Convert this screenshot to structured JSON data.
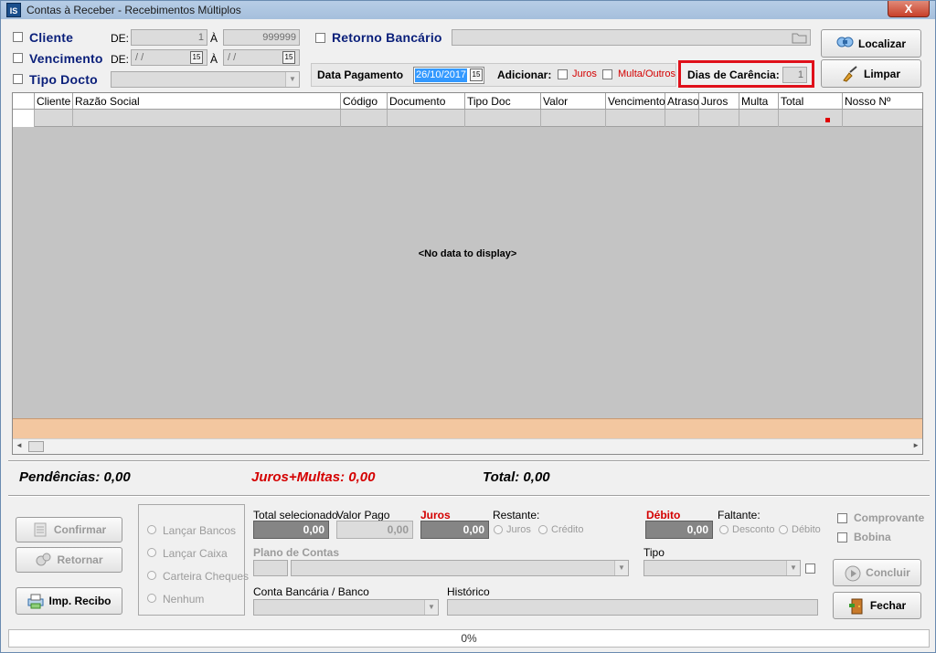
{
  "window": {
    "title": "Contas à Receber - Recebimentos Múltiplos",
    "app_icon_text": "IS",
    "close_label": "X"
  },
  "filters": {
    "cliente_label": "Cliente",
    "de_label": "DE:",
    "ate_label": "À",
    "cliente_from": "1",
    "cliente_to": "999999",
    "vencimento_label": "Vencimento",
    "venc_from": "/ /",
    "venc_to": "/ /",
    "tipo_docto_label": "Tipo Docto",
    "retorno_label": "Retorno Bancário"
  },
  "payment": {
    "data_pagamento_label": "Data Pagamento",
    "data_pagamento_value": "26/10/2017",
    "adicionar_label": "Adicionar:",
    "juros_label": "Juros",
    "multa_label": "Multa/Outros",
    "dias_carencia_label": "Dias de Carência:",
    "dias_carencia_value": "1"
  },
  "buttons": {
    "localizar": "Localizar",
    "limpar": "Limpar",
    "confirmar": "Confirmar",
    "retornar": "Retornar",
    "imp_recibo": "Imp. Recibo",
    "concluir": "Concluir",
    "fechar": "Fechar"
  },
  "grid": {
    "columns": [
      "Cliente",
      "Razão Social",
      "Código",
      "Documento",
      "Tipo Doc",
      "Valor",
      "Vencimento",
      "Atraso",
      "Juros",
      "Multa",
      "Total",
      "Nosso Nº"
    ],
    "empty_text": "<No data to display>"
  },
  "totals": {
    "pendencias": "Pendências: 0,00",
    "juros_multas": "Juros+Multas: 0,00",
    "total": "Total: 0,00"
  },
  "actions": {
    "lancar_bancos": "Lançar Bancos",
    "lancar_caixa": "Lançar Caixa",
    "carteira_cheques": "Carteira Cheques",
    "nenhum": "Nenhum"
  },
  "values": {
    "total_selecionado_label": "Total selecionado",
    "total_selecionado": "0,00",
    "valor_pago_label": "Valor Pago",
    "valor_pago": "0,00",
    "juros_label": "Juros",
    "juros": "0,00",
    "restante_label": "Restante:",
    "restante_juros": "Juros",
    "restante_credito": "Crédito",
    "debito_label": "Débito",
    "debito": "0,00",
    "faltante_label": "Faltante:",
    "faltante_desconto": "Desconto",
    "faltante_debito": "Débito",
    "plano_contas_label": "Plano de Contas",
    "tipo_label": "Tipo",
    "conta_bancaria_label": "Conta Bancária / Banco",
    "historico_label": "Histórico"
  },
  "options": {
    "comprovante": "Comprovante",
    "bobina": "Bobina"
  },
  "status": {
    "progress": "0%"
  }
}
